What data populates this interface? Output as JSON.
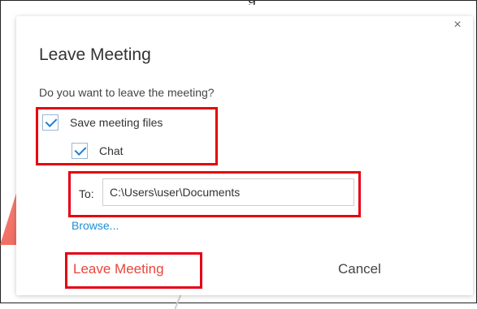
{
  "page_title_fragment": "g",
  "dialog": {
    "title": "Leave Meeting",
    "close_symbol": "×",
    "question": "Do you want to leave the meeting?",
    "options": {
      "save_files_label": "Save meeting files",
      "save_files_checked": true,
      "chat_label": "Chat",
      "chat_checked": true
    },
    "to_label": "To:",
    "to_value": "C:\\Users\\user\\Documents",
    "browse_label": "Browse...",
    "leave_button": "Leave Meeting",
    "cancel_button": "Cancel"
  },
  "colors": {
    "accent": "#1e7fd6",
    "danger": "#e8463c",
    "annotation": "#e60012"
  }
}
